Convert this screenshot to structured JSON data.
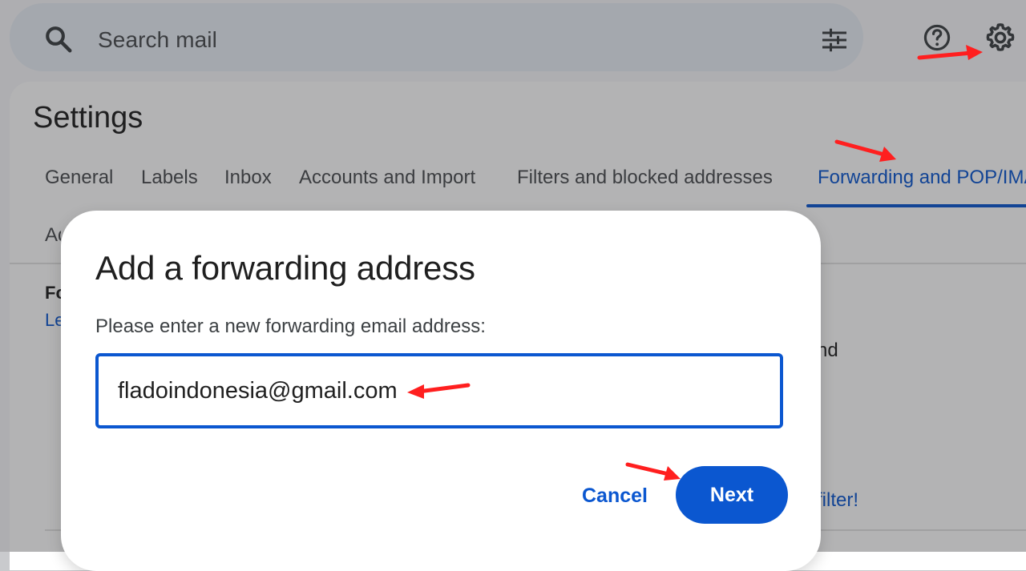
{
  "header": {
    "search": {
      "placeholder": "Search mail",
      "search_icon": "search-icon",
      "filter_icon": "tune-icon"
    },
    "help_icon": "help-icon",
    "settings_icon": "gear-icon"
  },
  "settings": {
    "title": "Settings",
    "tabs": [
      {
        "label": "General",
        "active": false
      },
      {
        "label": "Labels",
        "active": false
      },
      {
        "label": "Inbox",
        "active": false
      },
      {
        "label": "Accounts and Import",
        "active": false
      },
      {
        "label": "Filters and blocked addresses",
        "active": false
      },
      {
        "label": "Forwarding and POP/IMAP",
        "active": true
      }
    ],
    "visible_row_2_fragment": "Ad",
    "visible_left_fragments": {
      "heading": "Fo",
      "link": "Le"
    },
    "visible_right_fragments": {
      "text": "nd",
      "link": "filter!"
    }
  },
  "dialog": {
    "title": "Add a forwarding address",
    "label": "Please enter a new forwarding email address:",
    "email_value": "fladoindonesia@gmail.com",
    "cancel_label": "Cancel",
    "next_label": "Next"
  },
  "colors": {
    "accent": "#0b57d0",
    "annotation_red": "#ff1f1f"
  }
}
